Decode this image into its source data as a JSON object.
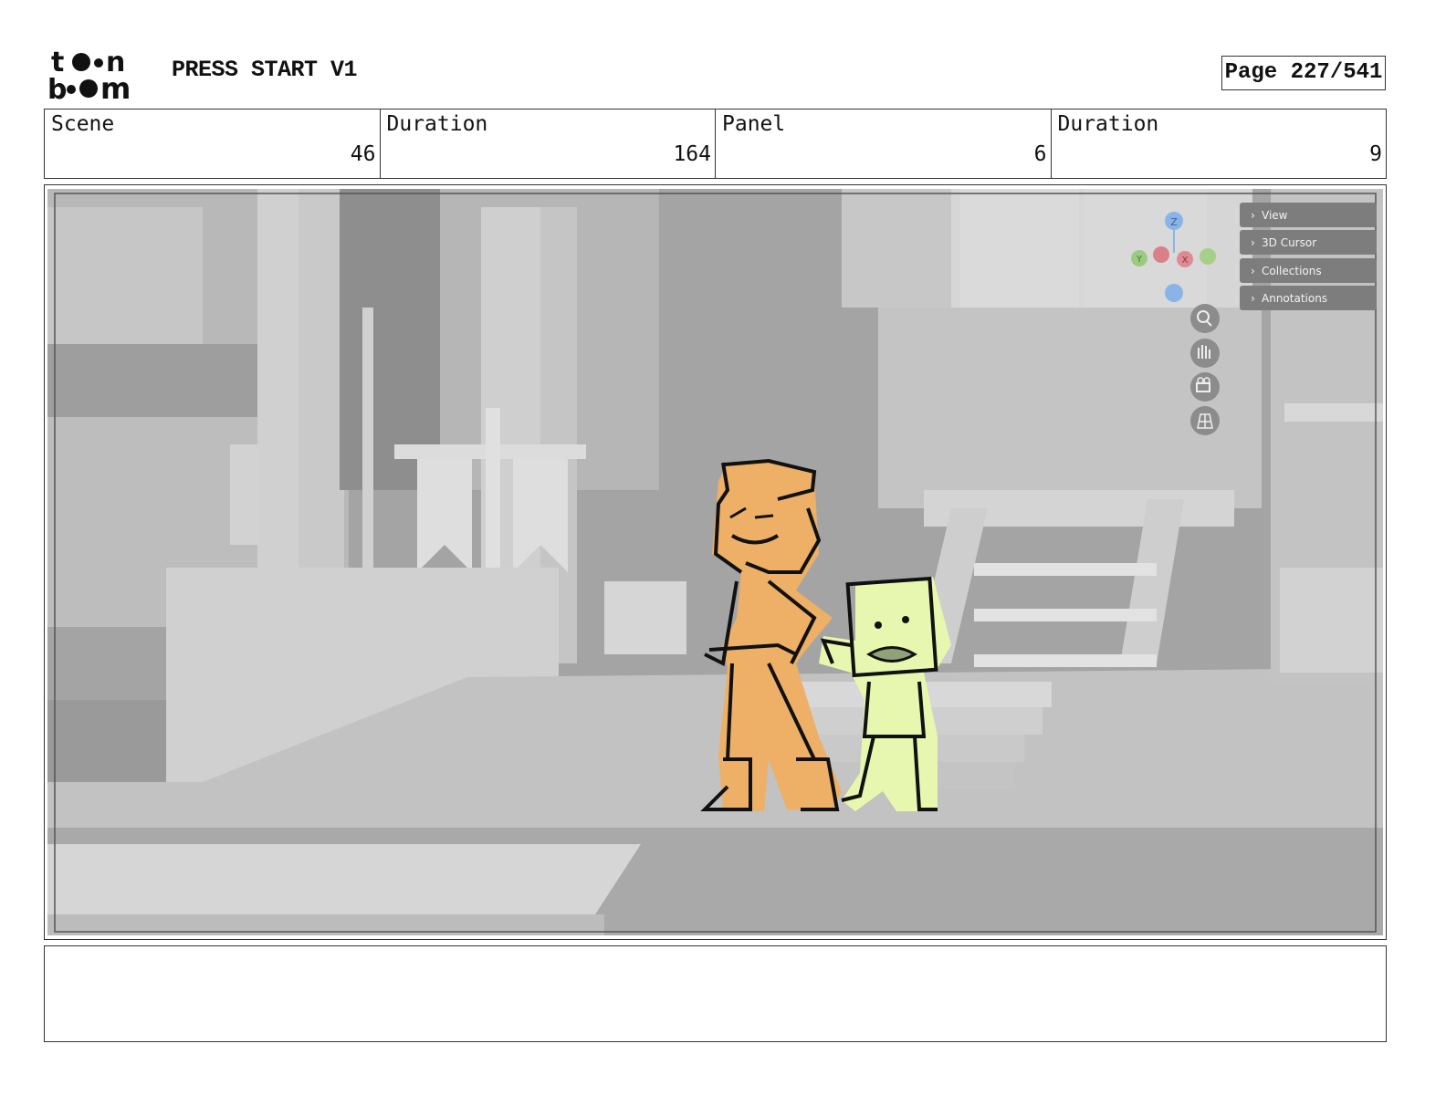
{
  "header": {
    "logo_text": "toon boom",
    "project_title": "PRESS START V1",
    "page_label": "Page 227/541"
  },
  "info": {
    "scene_label": "Scene",
    "scene_value": "46",
    "scene_duration_label": "Duration",
    "scene_duration_value": "164",
    "panel_label": "Panel",
    "panel_value": "6",
    "panel_duration_label": "Duration",
    "panel_duration_value": "9"
  },
  "viewport": {
    "gizmo_axes": [
      "Z",
      "Y",
      "X"
    ],
    "sidebar_tabs": [
      "View",
      "3D Cursor",
      "Collections",
      "Annotations"
    ],
    "tools": [
      "zoom-icon",
      "hand-icon",
      "camera-icon",
      "grid-icon"
    ]
  },
  "colors": {
    "tall_character": "#edb066",
    "short_character": "#e8f7b0",
    "set_gray": "#a3a3a3",
    "axis_z": "#8ab4e8",
    "axis_y": "#9ccb7f",
    "axis_x": "#e08a91"
  },
  "notes": {
    "text": ""
  }
}
